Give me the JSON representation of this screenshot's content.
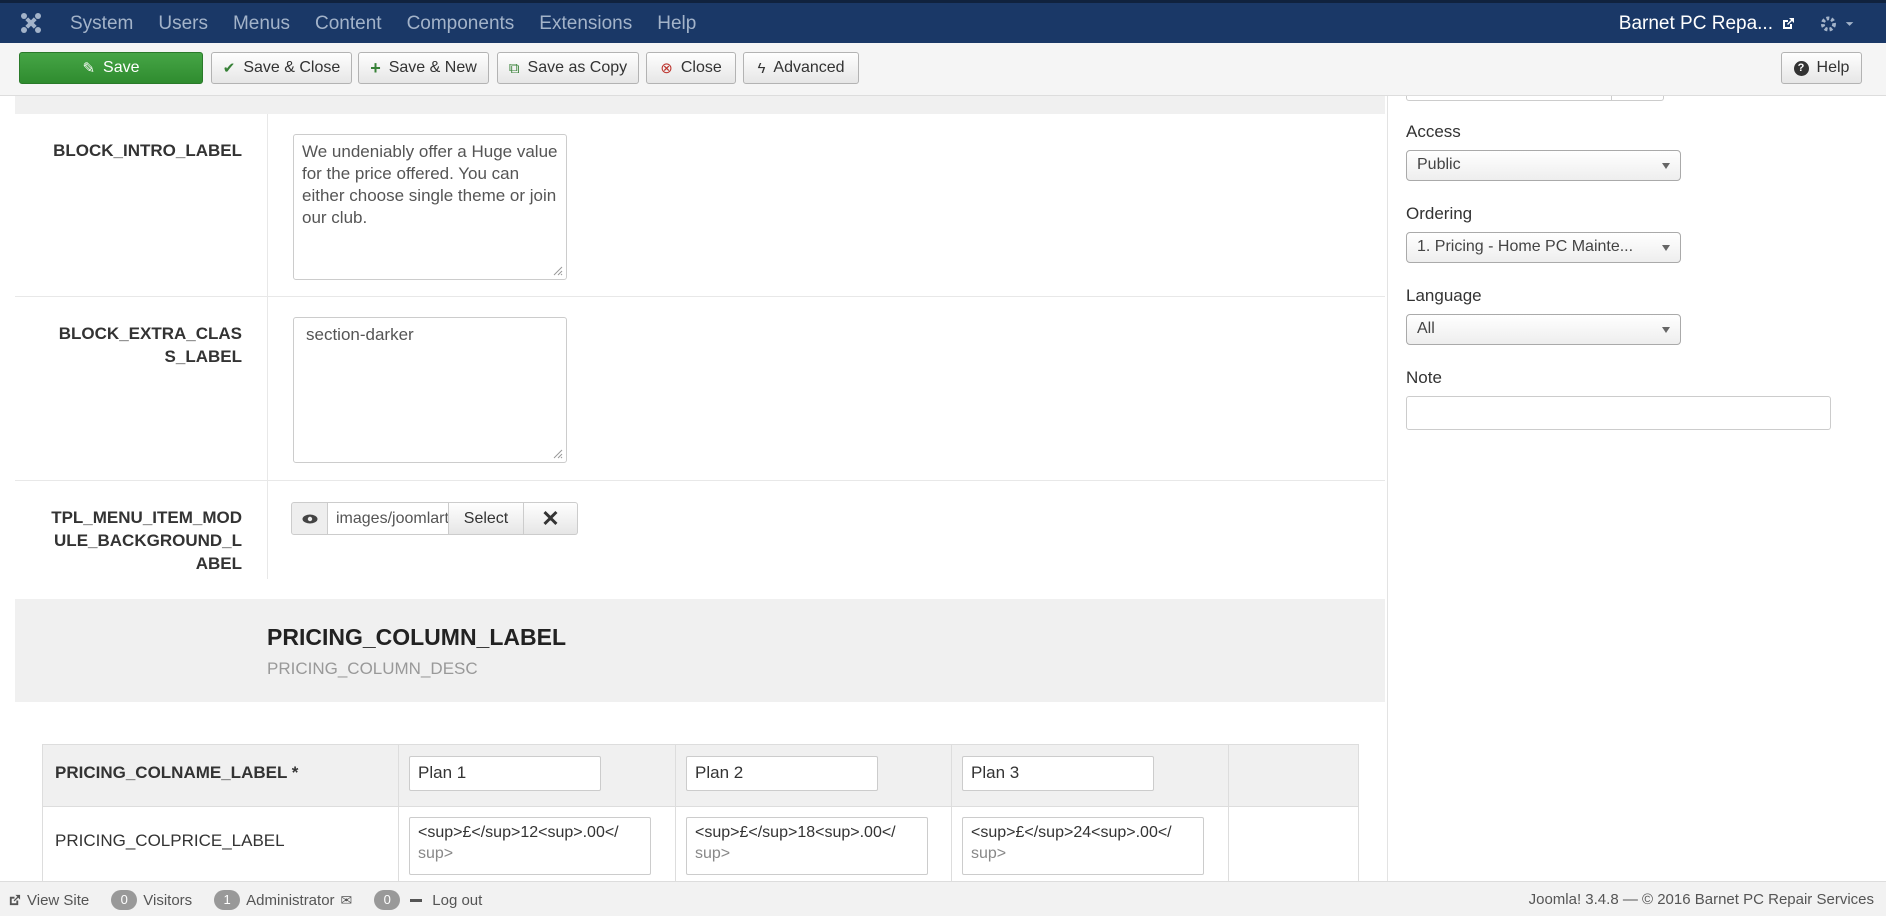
{
  "navbar": {
    "menu": [
      "System",
      "Users",
      "Menus",
      "Content",
      "Components",
      "Extensions",
      "Help"
    ],
    "site_name": "Barnet PC Repa...",
    "icons": {
      "logo": "joomla-logo",
      "external": "external-link-icon",
      "settings": "gear-icon"
    }
  },
  "toolbar": {
    "save": "Save",
    "save_close": "Save & Close",
    "save_new": "Save & New",
    "save_copy": "Save as Copy",
    "close": "Close",
    "advanced": "Advanced",
    "help": "Help"
  },
  "form": {
    "rows": [
      {
        "label": "BLOCK_INTRO_LABEL",
        "value": "We undeniably offer a Huge value for the price offered. You can either choose single theme or join our club."
      },
      {
        "label": "BLOCK_EXTRA_CLAS S_LABEL",
        "label_lines": [
          "BLOCK_EXTRA_CLAS",
          "S_LABEL"
        ],
        "value": "section-darker"
      },
      {
        "label_lines": [
          "TPL_MENU_ITEM_MOD",
          "ULE_BACKGROUND_L",
          "ABEL"
        ],
        "media_path": "images/joomlart",
        "select_label": "Select"
      }
    ],
    "section": {
      "title": "PRICING_COLUMN_LABEL",
      "desc": "PRICING_COLUMN_DESC"
    },
    "pricing": {
      "colname_label": "PRICING_COLNAME_LABEL *",
      "colprice_label": "PRICING_COLPRICE_LABEL",
      "plans": [
        "Plan 1",
        "Plan 2",
        "Plan 3"
      ],
      "prices": [
        [
          "<sup>£</sup>12<sup>.00</",
          "sup>"
        ],
        [
          "<sup>£</sup>18<sup>.00</",
          "sup>"
        ],
        [
          "<sup>£</sup>24<sup>.00</",
          "sup>"
        ]
      ]
    }
  },
  "sidebar": {
    "access_label": "Access",
    "access_value": "Public",
    "ordering_label": "Ordering",
    "ordering_value": "1. Pricing - Home PC Mainte...",
    "language_label": "Language",
    "language_value": "All",
    "note_label": "Note",
    "note_value": ""
  },
  "statusbar": {
    "view_site": "View Site",
    "visitors_count": "0",
    "visitors_label": "Visitors",
    "admin_count": "1",
    "admin_label": "Administrator",
    "messages_count": "0",
    "logout": "Log out",
    "version": "Joomla! 3.4.8 — © 2016 Barnet PC Repair Services"
  },
  "colors": {
    "navbar": "#1a3867",
    "save_button": "#46a546",
    "close_icon": "#bd362f"
  }
}
